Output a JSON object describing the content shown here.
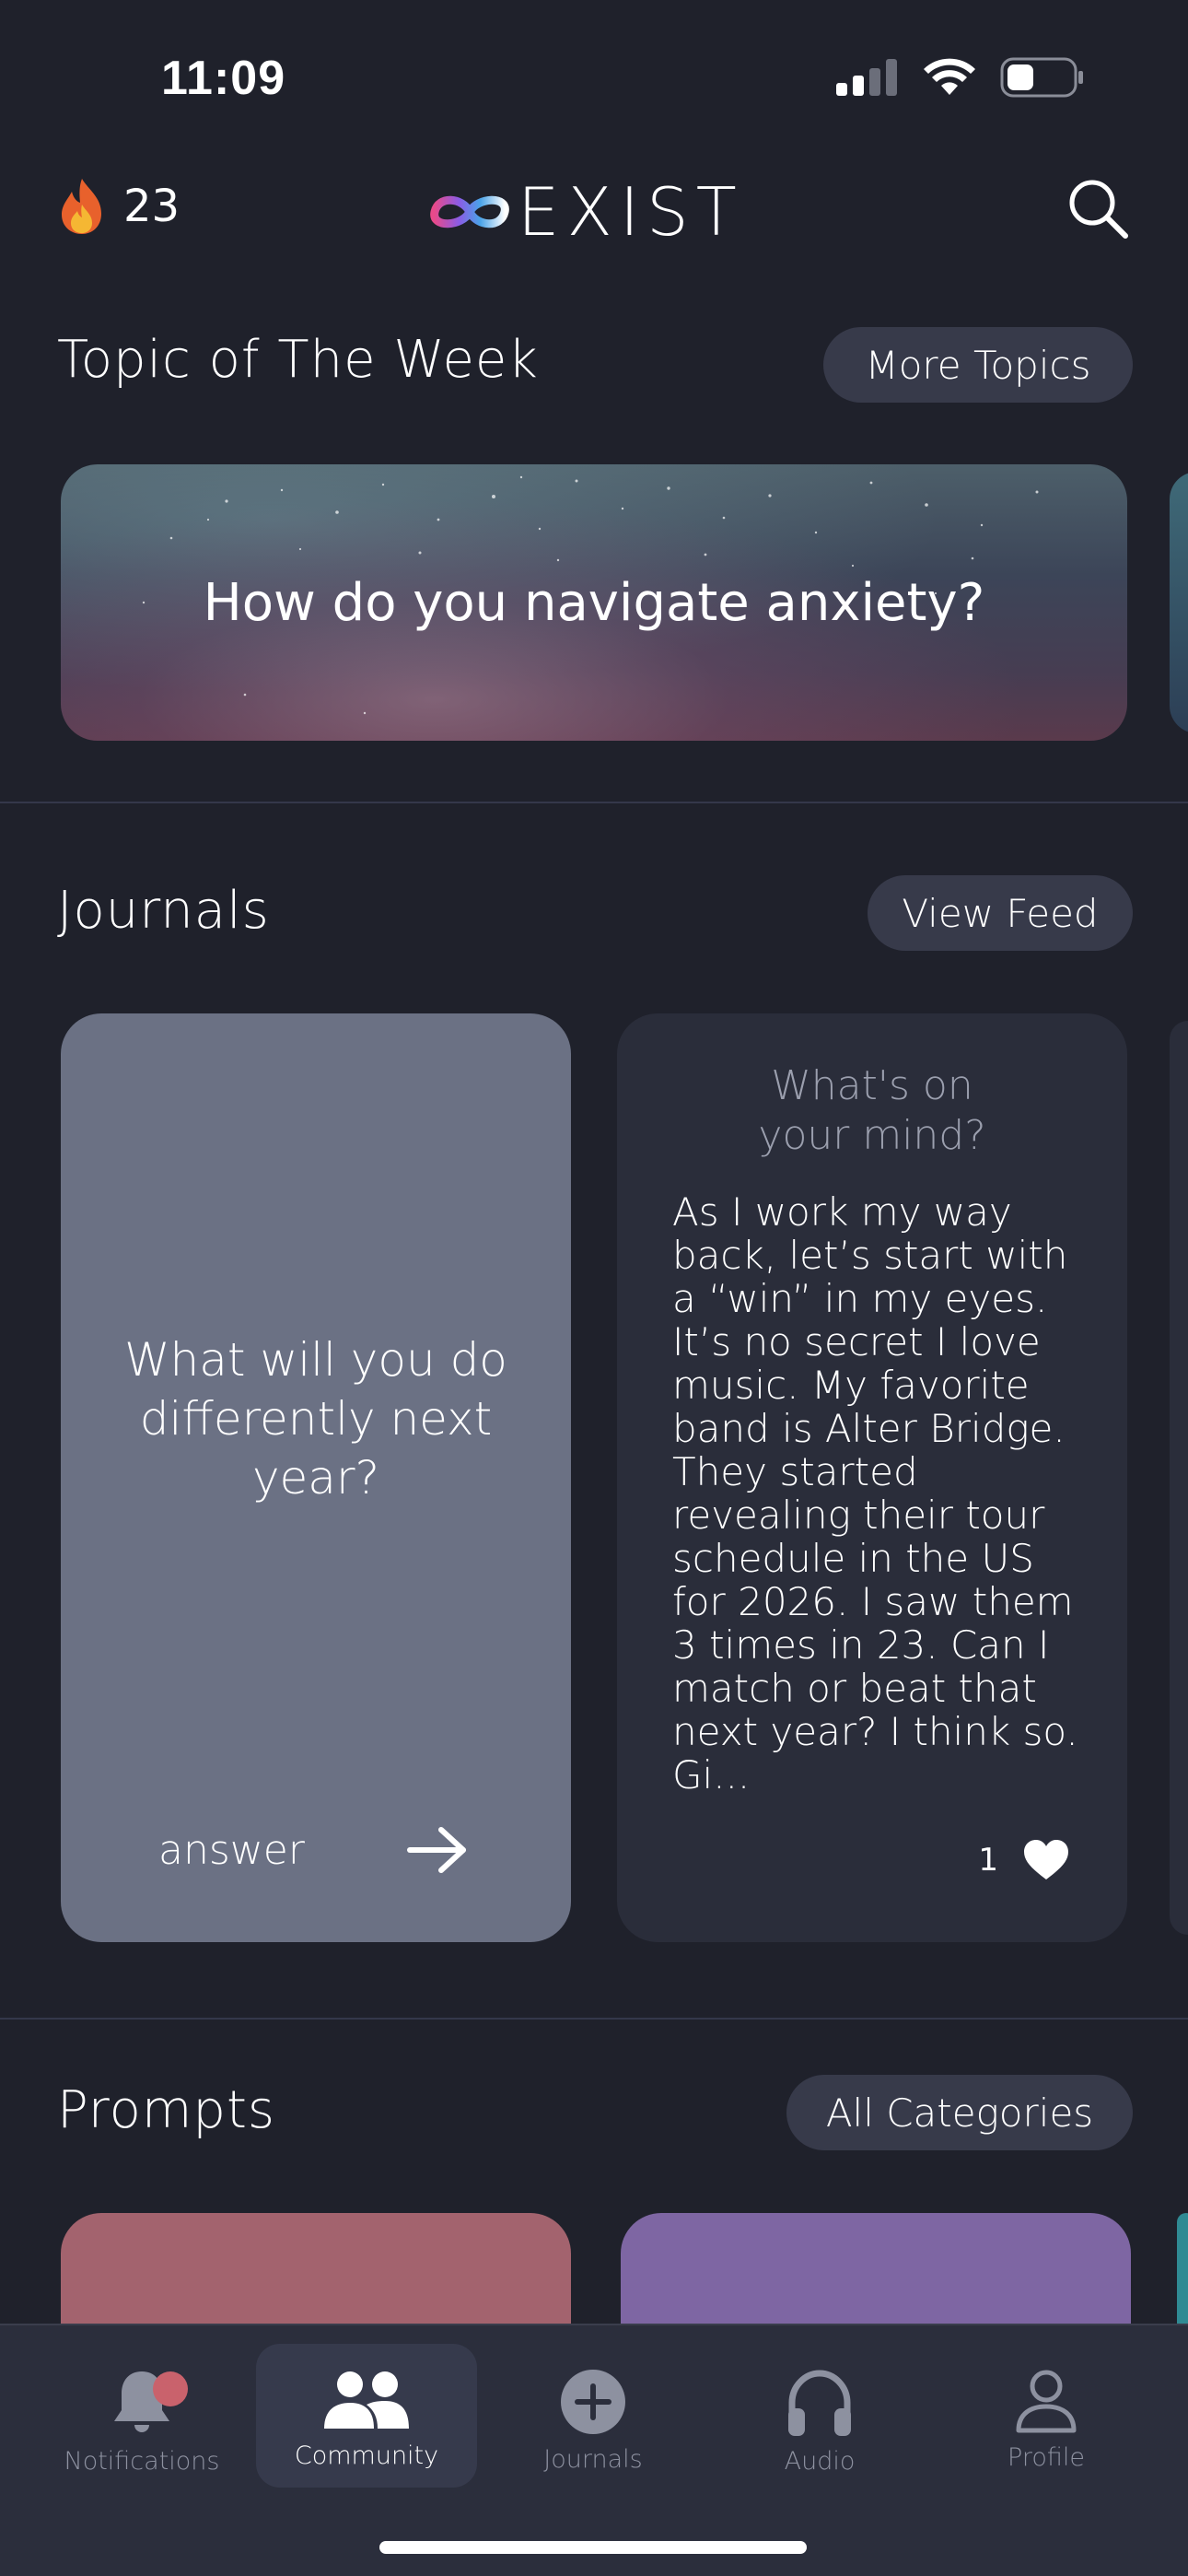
{
  "status_bar": {
    "time": "11:09"
  },
  "header": {
    "streak_count": "23",
    "brand": "EXIST",
    "icons": [
      "fire-icon",
      "infinity-logo-icon",
      "search-icon"
    ]
  },
  "topic_section": {
    "title": "Topic of The Week",
    "more_label": "More Topics",
    "card_text": "How do you navigate anxiety?"
  },
  "journals_section": {
    "title": "Journals",
    "view_label": "View Feed",
    "question_card": {
      "question": "What will you do differently next year?",
      "answer_label": "answer"
    },
    "entry_card": {
      "prompt": "What's on your mind?",
      "entry_text": "As I work my way back, let’s start with a “win” in my eyes. It’s no secret I love music. My favorite band is Alter Bridge. They started revealing their tour schedule in the US for 2026. I saw them 3 times in 23. Can I match or beat that next year? I think so. Gi...",
      "likes": "1"
    }
  },
  "prompts_section": {
    "title": "Prompts",
    "categories_label": "All Categories",
    "card_colors": [
      "#a3636e",
      "#7e66a3",
      "#2f8a93"
    ]
  },
  "tab_bar": {
    "tabs": [
      {
        "label": "Notifications",
        "icon": "bell-icon"
      },
      {
        "label": "Community",
        "icon": "community-icon",
        "active": true
      },
      {
        "label": "Journals",
        "icon": "add-circle-icon"
      },
      {
        "label": "Audio",
        "icon": "headphones-icon"
      },
      {
        "label": "Profile",
        "icon": "profile-icon"
      }
    ]
  },
  "colors": {
    "background": "#1f212b",
    "pill": "#373a4a",
    "question_card": "#6b7184",
    "entry_card": "#2a2d3a",
    "notification_dot": "#c9626c"
  }
}
